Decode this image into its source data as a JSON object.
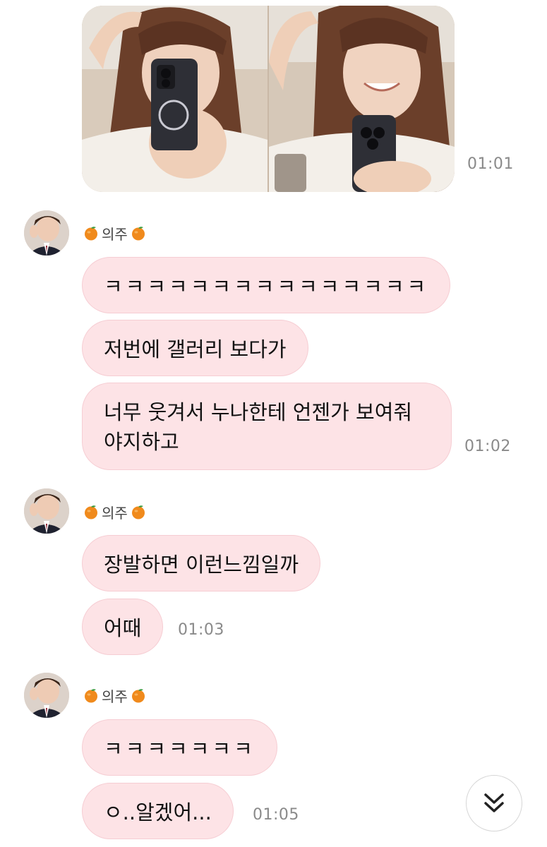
{
  "chat": {
    "photo_message": {
      "time": "01:01",
      "icon_left": "selfie-photo",
      "icon_right": "selfie-photo"
    },
    "groups": [
      {
        "sender": "의주",
        "emoji": "tangerine-icon",
        "messages": [
          "ㅋㅋㅋㅋㅋㅋㅋㅋㅋㅋㅋㅋㅋㅋㅋ",
          "저번에 갤러리 보다가",
          "너무 웃겨서 누나한테 언젠가 보여줘\n야지하고"
        ],
        "time": "01:02"
      },
      {
        "sender": "의주",
        "emoji": "tangerine-icon",
        "messages": [
          "장발하면 이런느낌일까",
          "어때"
        ],
        "time": "01:03"
      },
      {
        "sender": "의주",
        "emoji": "tangerine-icon",
        "messages": [
          "ㅋㅋㅋㅋㅋㅋㅋ",
          "ㅇ..알겠어..."
        ],
        "time": "01:05"
      }
    ]
  },
  "scroll_button": {
    "icon": "double-chevron-down-icon"
  },
  "colors": {
    "bubble": "#fde3e6",
    "bubble_border": "#f6cdd3",
    "time": "#8a8a8a"
  }
}
